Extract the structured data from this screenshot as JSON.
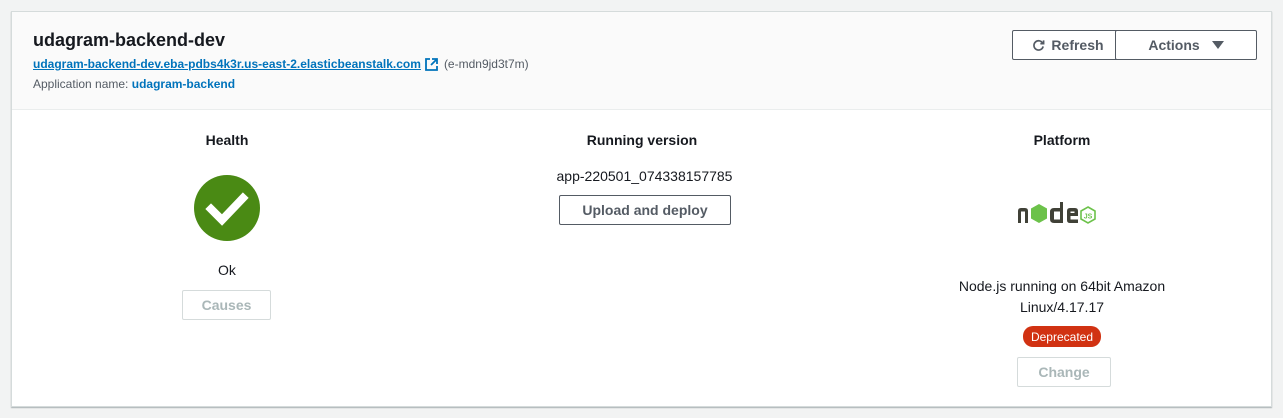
{
  "environment": {
    "name": "udagram-backend-dev",
    "url": "udagram-backend-dev.eba-pdbs4k3r.us-east-2.elasticbeanstalk.com",
    "id_text": "(e-mdn9jd3t7m)",
    "application_label": "Application name: ",
    "application_name": "udagram-backend"
  },
  "header_buttons": {
    "refresh_label": "Refresh",
    "refresh_icon": "refresh-icon",
    "actions_label": "Actions",
    "actions_icon": "caret-down-icon"
  },
  "health": {
    "title": "Health",
    "status": "Ok",
    "status_icon": "check-circle-icon",
    "status_color": "#4a8a14",
    "causes_label": "Causes"
  },
  "running_version": {
    "title": "Running version",
    "version": "app-220501_074338157785",
    "deploy_label": "Upload and deploy"
  },
  "platform": {
    "title": "Platform",
    "logo_icon": "nodejs-logo",
    "description": "Node.js running on 64bit Amazon Linux/4.17.17",
    "badge": "Deprecated",
    "badge_color": "#d13212",
    "change_label": "Change"
  }
}
